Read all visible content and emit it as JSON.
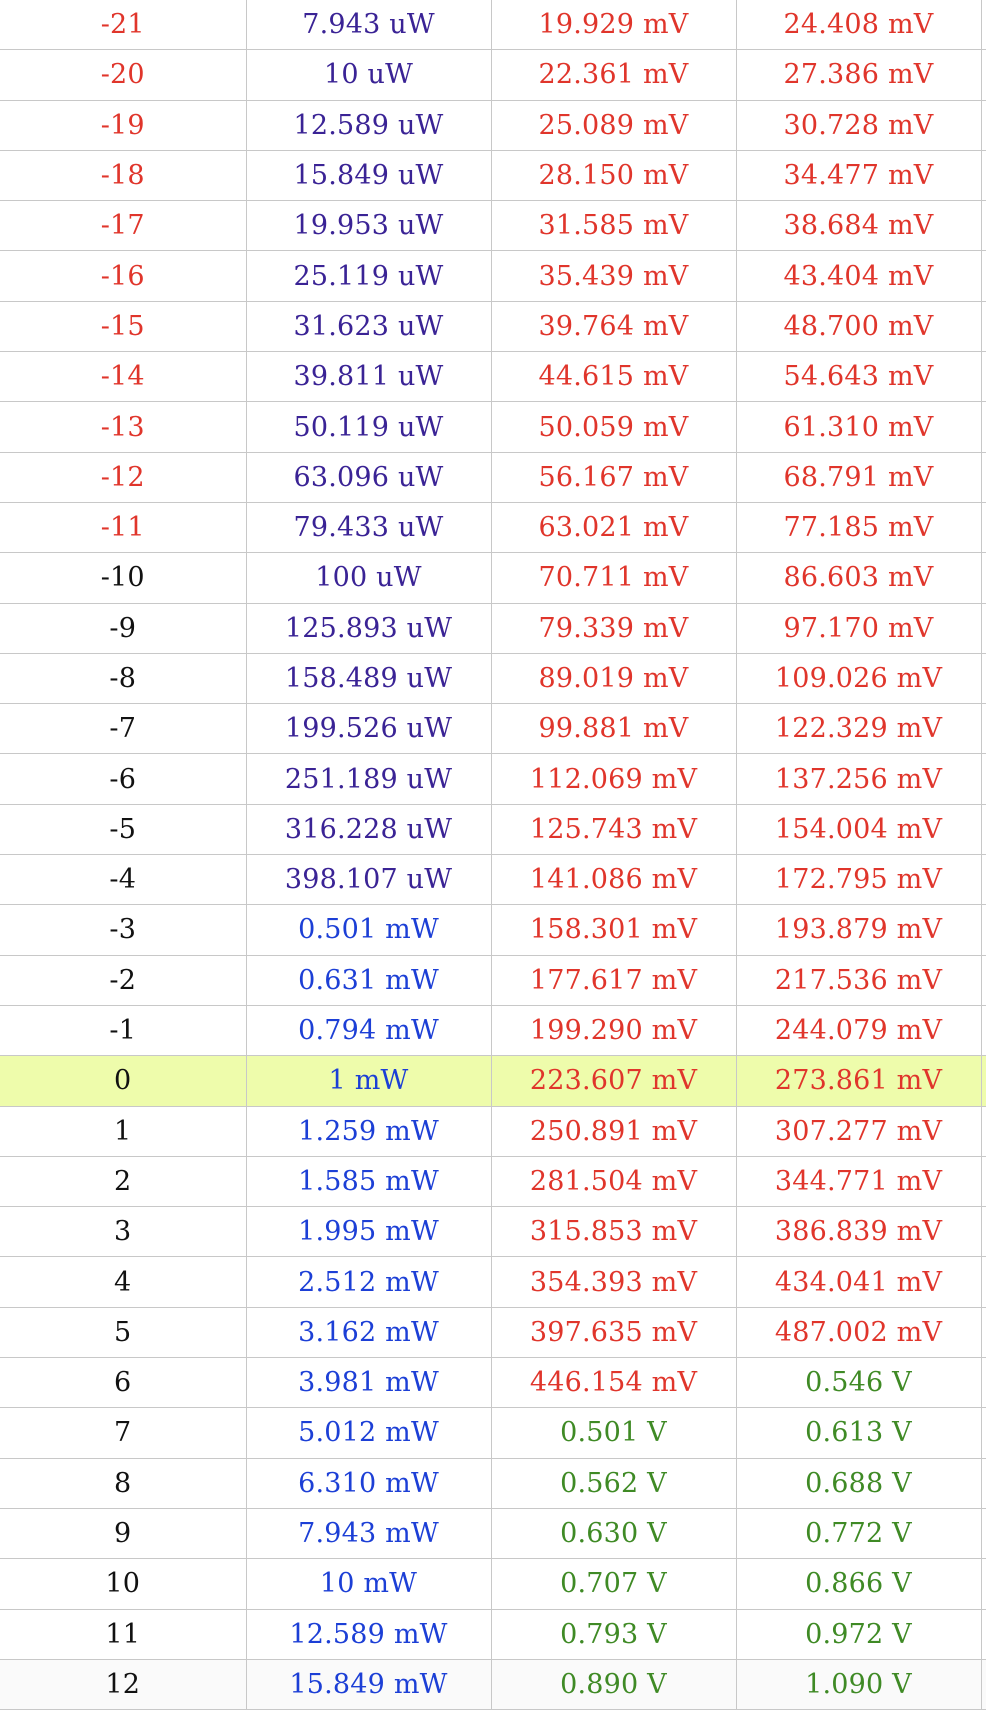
{
  "table": {
    "rows": [
      {
        "dbm": "-21",
        "power": "7.943 uW",
        "v_a": "19.929 mV",
        "v_b": "24.408 mV",
        "c1": "red",
        "c2": "purple",
        "c3": "red",
        "c4": "red"
      },
      {
        "dbm": "-20",
        "power": "10 uW",
        "v_a": "22.361 mV",
        "v_b": "27.386 mV",
        "c1": "red",
        "c2": "purple",
        "c3": "red",
        "c4": "red"
      },
      {
        "dbm": "-19",
        "power": "12.589 uW",
        "v_a": "25.089 mV",
        "v_b": "30.728 mV",
        "c1": "red",
        "c2": "purple",
        "c3": "red",
        "c4": "red"
      },
      {
        "dbm": "-18",
        "power": "15.849 uW",
        "v_a": "28.150 mV",
        "v_b": "34.477 mV",
        "c1": "red",
        "c2": "purple",
        "c3": "red",
        "c4": "red"
      },
      {
        "dbm": "-17",
        "power": "19.953 uW",
        "v_a": "31.585 mV",
        "v_b": "38.684 mV",
        "c1": "red",
        "c2": "purple",
        "c3": "red",
        "c4": "red"
      },
      {
        "dbm": "-16",
        "power": "25.119 uW",
        "v_a": "35.439 mV",
        "v_b": "43.404 mV",
        "c1": "red",
        "c2": "purple",
        "c3": "red",
        "c4": "red"
      },
      {
        "dbm": "-15",
        "power": "31.623 uW",
        "v_a": "39.764 mV",
        "v_b": "48.700 mV",
        "c1": "red",
        "c2": "purple",
        "c3": "red",
        "c4": "red"
      },
      {
        "dbm": "-14",
        "power": "39.811 uW",
        "v_a": "44.615 mV",
        "v_b": "54.643 mV",
        "c1": "red",
        "c2": "purple",
        "c3": "red",
        "c4": "red"
      },
      {
        "dbm": "-13",
        "power": "50.119 uW",
        "v_a": "50.059 mV",
        "v_b": "61.310 mV",
        "c1": "red",
        "c2": "purple",
        "c3": "red",
        "c4": "red"
      },
      {
        "dbm": "-12",
        "power": "63.096 uW",
        "v_a": "56.167 mV",
        "v_b": "68.791 mV",
        "c1": "red",
        "c2": "purple",
        "c3": "red",
        "c4": "red"
      },
      {
        "dbm": "-11",
        "power": "79.433 uW",
        "v_a": "63.021 mV",
        "v_b": "77.185 mV",
        "c1": "red",
        "c2": "purple",
        "c3": "red",
        "c4": "red"
      },
      {
        "dbm": "-10",
        "power": "100 uW",
        "v_a": "70.711 mV",
        "v_b": "86.603 mV",
        "c1": "black",
        "c2": "purple",
        "c3": "red",
        "c4": "red"
      },
      {
        "dbm": "-9",
        "power": "125.893 uW",
        "v_a": "79.339 mV",
        "v_b": "97.170 mV",
        "c1": "black",
        "c2": "purple",
        "c3": "red",
        "c4": "red"
      },
      {
        "dbm": "-8",
        "power": "158.489 uW",
        "v_a": "89.019 mV",
        "v_b": "109.026 mV",
        "c1": "black",
        "c2": "purple",
        "c3": "red",
        "c4": "red"
      },
      {
        "dbm": "-7",
        "power": "199.526 uW",
        "v_a": "99.881 mV",
        "v_b": "122.329 mV",
        "c1": "black",
        "c2": "purple",
        "c3": "red",
        "c4": "red"
      },
      {
        "dbm": "-6",
        "power": "251.189 uW",
        "v_a": "112.069 mV",
        "v_b": "137.256 mV",
        "c1": "black",
        "c2": "purple",
        "c3": "red",
        "c4": "red"
      },
      {
        "dbm": "-5",
        "power": "316.228 uW",
        "v_a": "125.743 mV",
        "v_b": "154.004 mV",
        "c1": "black",
        "c2": "purple",
        "c3": "red",
        "c4": "red"
      },
      {
        "dbm": "-4",
        "power": "398.107 uW",
        "v_a": "141.086 mV",
        "v_b": "172.795 mV",
        "c1": "black",
        "c2": "purple",
        "c3": "red",
        "c4": "red"
      },
      {
        "dbm": "-3",
        "power": "0.501 mW",
        "v_a": "158.301 mV",
        "v_b": "193.879 mV",
        "c1": "black",
        "c2": "blue",
        "c3": "red",
        "c4": "red"
      },
      {
        "dbm": "-2",
        "power": "0.631 mW",
        "v_a": "177.617 mV",
        "v_b": "217.536 mV",
        "c1": "black",
        "c2": "blue",
        "c3": "red",
        "c4": "red"
      },
      {
        "dbm": "-1",
        "power": "0.794 mW",
        "v_a": "199.290 mV",
        "v_b": "244.079 mV",
        "c1": "black",
        "c2": "blue",
        "c3": "red",
        "c4": "red"
      },
      {
        "dbm": "0",
        "power": "1 mW",
        "v_a": "223.607 mV",
        "v_b": "273.861 mV",
        "c1": "black",
        "c2": "blue",
        "c3": "red",
        "c4": "red",
        "highlight": true
      },
      {
        "dbm": "1",
        "power": "1.259 mW",
        "v_a": "250.891 mV",
        "v_b": "307.277 mV",
        "c1": "black",
        "c2": "blue",
        "c3": "red",
        "c4": "red"
      },
      {
        "dbm": "2",
        "power": "1.585 mW",
        "v_a": "281.504 mV",
        "v_b": "344.771 mV",
        "c1": "black",
        "c2": "blue",
        "c3": "red",
        "c4": "red"
      },
      {
        "dbm": "3",
        "power": "1.995 mW",
        "v_a": "315.853 mV",
        "v_b": "386.839 mV",
        "c1": "black",
        "c2": "blue",
        "c3": "red",
        "c4": "red"
      },
      {
        "dbm": "4",
        "power": "2.512 mW",
        "v_a": "354.393 mV",
        "v_b": "434.041 mV",
        "c1": "black",
        "c2": "blue",
        "c3": "red",
        "c4": "red"
      },
      {
        "dbm": "5",
        "power": "3.162 mW",
        "v_a": "397.635 mV",
        "v_b": "487.002 mV",
        "c1": "black",
        "c2": "blue",
        "c3": "red",
        "c4": "red"
      },
      {
        "dbm": "6",
        "power": "3.981 mW",
        "v_a": "446.154 mV",
        "v_b": "0.546 V",
        "c1": "black",
        "c2": "blue",
        "c3": "red",
        "c4": "green"
      },
      {
        "dbm": "7",
        "power": "5.012 mW",
        "v_a": "0.501 V",
        "v_b": "0.613 V",
        "c1": "black",
        "c2": "blue",
        "c3": "green",
        "c4": "green"
      },
      {
        "dbm": "8",
        "power": "6.310 mW",
        "v_a": "0.562 V",
        "v_b": "0.688 V",
        "c1": "black",
        "c2": "blue",
        "c3": "green",
        "c4": "green"
      },
      {
        "dbm": "9",
        "power": "7.943 mW",
        "v_a": "0.630 V",
        "v_b": "0.772 V",
        "c1": "black",
        "c2": "blue",
        "c3": "green",
        "c4": "green"
      },
      {
        "dbm": "10",
        "power": "10 mW",
        "v_a": "0.707 V",
        "v_b": "0.866 V",
        "c1": "black",
        "c2": "blue",
        "c3": "green",
        "c4": "green"
      },
      {
        "dbm": "11",
        "power": "12.589 mW",
        "v_a": "0.793 V",
        "v_b": "0.972 V",
        "c1": "black",
        "c2": "blue",
        "c3": "green",
        "c4": "green"
      },
      {
        "dbm": "12",
        "power": "15.849 mW",
        "v_a": "0.890 V",
        "v_b": "1.090 V",
        "c1": "black",
        "c2": "blue",
        "c3": "green",
        "c4": "green"
      }
    ]
  },
  "colors": {
    "red": "#e0352b",
    "black": "#111111",
    "purple": "#3a2395",
    "blue": "#1c3fd6",
    "green": "#3f8a25",
    "highlight_bg": "#eefcab",
    "grid_line": "#c8c8c8"
  }
}
